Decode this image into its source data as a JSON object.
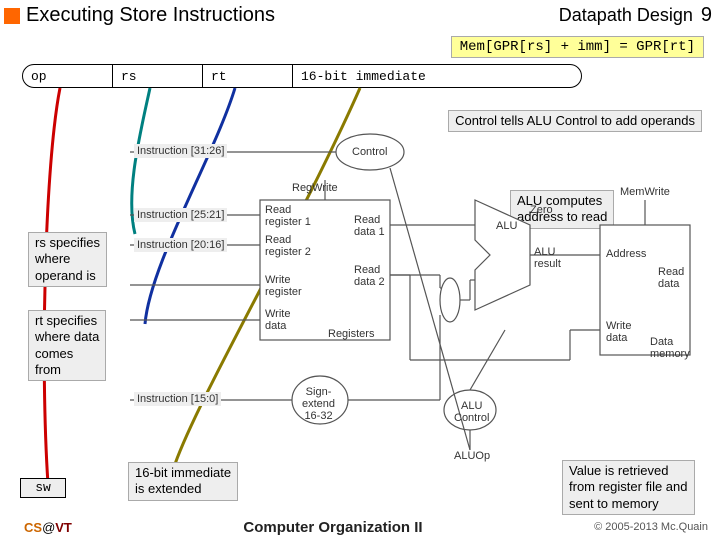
{
  "header": {
    "title": "Executing Store Instructions",
    "section": "Datapath Design",
    "page_number": "9"
  },
  "equation": "Mem[GPR[rs] + imm] = GPR[rt]",
  "instruction_format": {
    "op": "op",
    "rs": "rs",
    "rt": "rt",
    "imm": "16-bit immediate"
  },
  "annotations": {
    "control_tells": "Control tells ALU Control to add operands",
    "alu_computes": "ALU computes\naddress to read",
    "rs_specifies": "rs specifies\nwhere\noperand is",
    "rt_specifies": "rt specifies\nwhere data\ncomes\nfrom",
    "imm_extended": "16-bit immediate\nis extended",
    "value_retrieved": "Value is retrieved\nfrom register file and\nsent to memory"
  },
  "diagram": {
    "labels": {
      "instruction_top": "Instruction [31:26]",
      "instruction_rs": "Instruction [25:21]",
      "instruction_rt": "Instruction [20:16]",
      "instruction_imm": "Instruction [15:0]",
      "control": "Control",
      "regwrite": "RegWrite",
      "read_reg1": "Read\nregister 1",
      "read_reg2": "Read\nregister 2",
      "write_reg": "Write\nregister",
      "write_data": "Write\ndata",
      "registers": "Registers",
      "read_data1": "Read\ndata 1",
      "read_data2": "Read\ndata 2",
      "alu": "ALU",
      "alu_result": "ALU\nresult",
      "zero": "Zero",
      "sign_extend": "Sign-\nextend\n16-32",
      "alu_control": "ALU\nControl",
      "aluop": "ALUOp",
      "memwrite": "MemWrite",
      "address": "Address",
      "read_data": "Read\ndata",
      "write_data_mem": "Write\ndata",
      "data_memory": "Data\nmemory"
    }
  },
  "sw_label": "sw",
  "footer": {
    "left_cs": "CS",
    "left_at": "@",
    "left_vt": "VT",
    "center": "Computer Organization II",
    "right": "© 2005-2013 Mc.Quain"
  }
}
